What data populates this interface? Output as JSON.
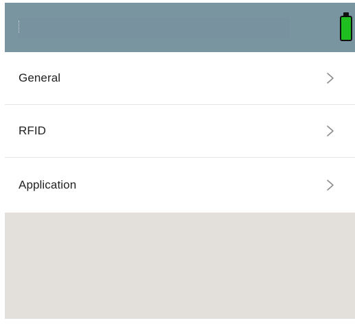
{
  "header": {
    "title": "",
    "battery_color": "#1fbf1f",
    "battery_level": 1.0,
    "background_color": "#7895a0"
  },
  "menu": {
    "items": [
      {
        "label": "General",
        "icon": "chevron-right-icon"
      },
      {
        "label": "RFID",
        "icon": "chevron-right-icon"
      },
      {
        "label": "Application",
        "icon": "chevron-right-icon"
      }
    ]
  }
}
